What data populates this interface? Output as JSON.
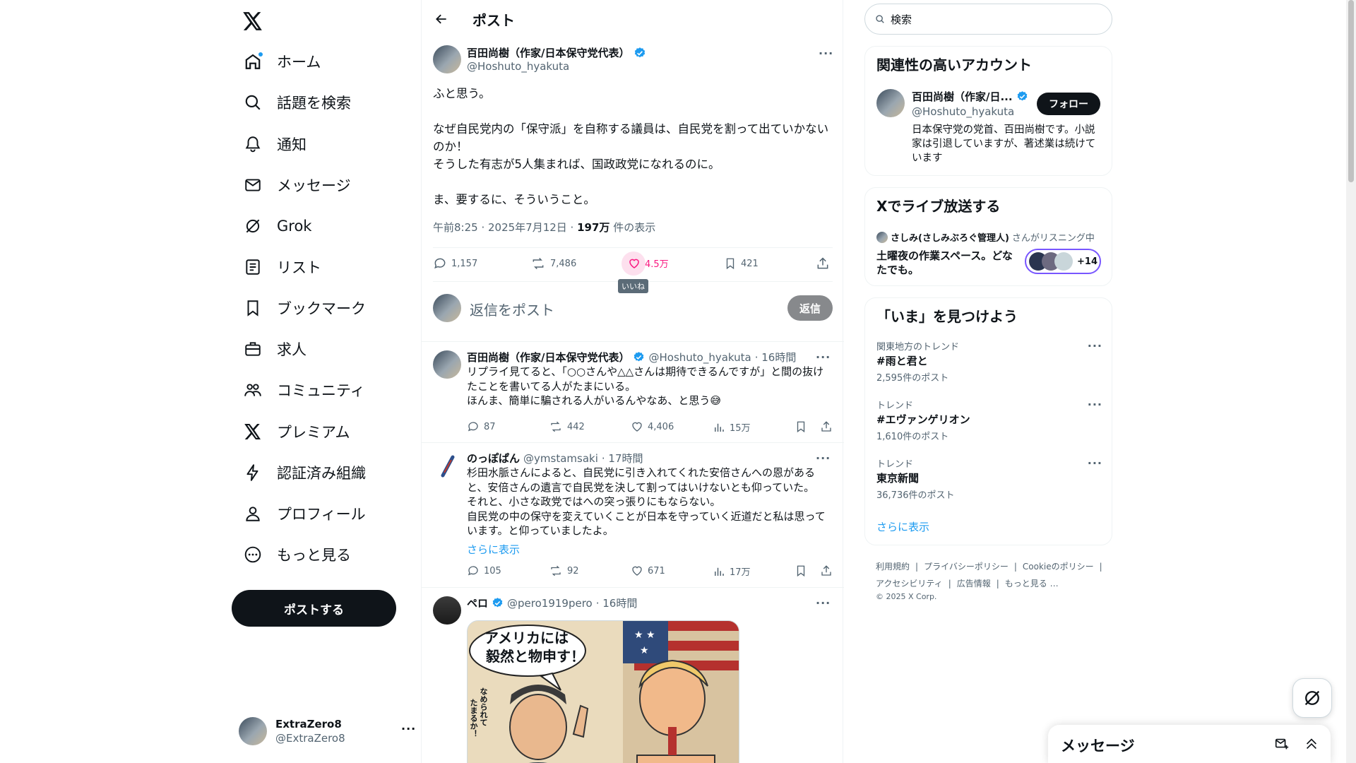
{
  "nav": {
    "items": [
      {
        "label": "ホーム",
        "icon": "home-icon"
      },
      {
        "label": "話題を検索",
        "icon": "search-icon"
      },
      {
        "label": "通知",
        "icon": "bell-icon"
      },
      {
        "label": "メッセージ",
        "icon": "mail-icon"
      },
      {
        "label": "Grok",
        "icon": "grok-icon"
      },
      {
        "label": "リスト",
        "icon": "list-icon"
      },
      {
        "label": "ブックマーク",
        "icon": "bookmark-icon"
      },
      {
        "label": "求人",
        "icon": "briefcase-icon"
      },
      {
        "label": "コミュニティ",
        "icon": "people-icon"
      },
      {
        "label": "プレミアム",
        "icon": "x-icon"
      },
      {
        "label": "認証済み組織",
        "icon": "lightning-icon"
      },
      {
        "label": "プロフィール",
        "icon": "person-icon"
      },
      {
        "label": "もっと見る",
        "icon": "more-circle-icon"
      }
    ],
    "post_button": "ポストする",
    "user": {
      "name": "ExtraZero8",
      "handle": "@ExtraZero8"
    }
  },
  "main": {
    "title": "ポスト",
    "post": {
      "author_name": "百田尚樹（作家/日本保守党代表）",
      "author_handle": "@Hoshuto_hyakuta",
      "text": "ふと思う。\n\nなぜ自民党内の「保守派」を自称する議員は、自民党を割って出ていかないのか！\nそうした有志が5人集まれば、国政政党になれるのに。\n\nま、要するに、そういうこと。",
      "time": "午前8:25 · 2025年7月12日 · ",
      "views": "197万",
      "views_suffix": " 件の表示",
      "replies": "1,157",
      "reposts": "7,486",
      "likes": "4.5万",
      "bookmarks": "421",
      "like_tooltip": "いいね"
    },
    "reply_box": {
      "placeholder": "返信をポスト",
      "button": "返信"
    },
    "replies": [
      {
        "name": "百田尚樹（作家/日本保守党代表）",
        "handle": "@Hoshuto_hyakuta",
        "time": "· 16時間",
        "text": "リプライ見てると、「○○さんや△△さんは期待できるんですが」と間の抜けたことを書いてる人がたまにいる。\nほんま、簡単に騙される人がいるんやなあ、と思う😅",
        "replies": "87",
        "reposts": "442",
        "likes": "4,406",
        "views": "15万"
      },
      {
        "name": "のっぽぱん",
        "handle": "@ymstamsaki",
        "time": "· 17時間",
        "text": "杉田水脈さんによると、自民党に引き入れてくれた安倍さんへの恩があると、安倍さんの遺言で自民党を決して割ってはいけないとも仰っていた。\nそれと、小さな政党ではへの突っ張りにもならない。\n自民党の中の保守を変えていくことが日本を守っていく近道だと私は思っています。と仰っていましたよ。",
        "show_more": "さらに表示",
        "replies": "105",
        "reposts": "92",
        "likes": "671",
        "views": "17万"
      },
      {
        "name": "ペロ",
        "handle": "@pero1919pero",
        "time": "· 16時間",
        "image_text_1": "アメリカには",
        "image_text_2": "毅然と物申す！",
        "image_text_3": "なめられて",
        "image_text_4": "たまるか！"
      }
    ]
  },
  "right": {
    "search_placeholder": "検索",
    "related": {
      "title": "関連性の高いアカウント",
      "name": "百田尚樹（作家/日...",
      "handle": "@Hoshuto_hyakuta",
      "follow": "フォロー",
      "bio": "日本保守党の党首、百田尚樹です。小説家は引退していますが、著述業は続けています"
    },
    "live": {
      "title": "Xでライブ放送する",
      "host": "さしみ(さしみぶろぐ管理人)",
      "host_suffix": "さんがリスニング中",
      "space_title": "土曜夜の作業スペース。どなたでも。",
      "listeners": "+14"
    },
    "trends": {
      "title": "「いま」を見つけよう",
      "items": [
        {
          "category": "関東地方のトレンド",
          "title": "#雨と君と",
          "count": "2,595件のポスト"
        },
        {
          "category": "トレンド",
          "title": "#エヴァンゲリオン",
          "count": "1,610件のポスト"
        },
        {
          "category": "トレンド",
          "title": "東京新聞",
          "count": "36,736件のポスト"
        }
      ],
      "show_more": "さらに表示"
    },
    "footer": {
      "links": [
        "利用規約",
        "プライバシーポリシー",
        "Cookieのポリシー",
        "アクセシビリティ",
        "広告情報",
        "もっと見る …"
      ],
      "copyright": "© 2025 X Corp."
    }
  },
  "messages_drawer": {
    "title": "メッセージ"
  },
  "colors": {
    "accent": "#1d9bf0",
    "like": "#f91880",
    "verified": "#1d9bf0",
    "live": "#7856ff"
  }
}
